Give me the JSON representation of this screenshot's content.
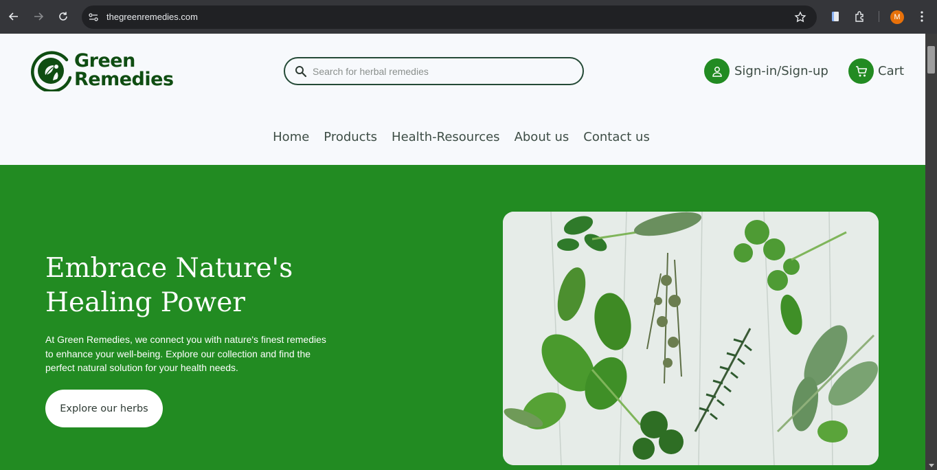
{
  "browser": {
    "url": "thegreenremedies.com",
    "profile_initial": "M"
  },
  "site": {
    "logo": {
      "line1": "Green",
      "line2": "Remedies"
    },
    "search": {
      "placeholder": "Search for herbal remedies"
    },
    "signin_label": "Sign-in/Sign-up",
    "cart_label": "Cart",
    "menu": [
      {
        "label": "Home"
      },
      {
        "label": "Products"
      },
      {
        "label": "Health-Resources"
      },
      {
        "label": "About us"
      },
      {
        "label": "Contact us"
      }
    ]
  },
  "hero": {
    "title_line1": "Embrace Nature's",
    "title_line2": "Healing Power",
    "text": "At Green Remedies, we connect you with nature's finest remedies to enhance your well-being. Explore our collection and find the perfect natural solution for your health needs.",
    "button_label": "Explore our herbs"
  },
  "colors": {
    "brand_green": "#228b22",
    "logo_dark_green": "#0f4d12",
    "header_bg": "#f7f9fc"
  }
}
